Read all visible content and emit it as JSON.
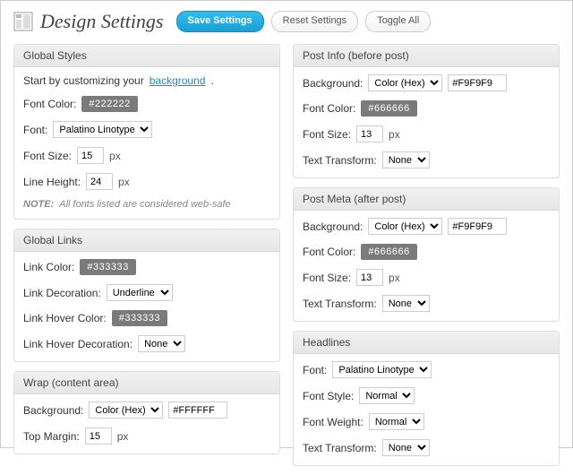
{
  "header": {
    "title": "Design Settings",
    "save": "Save Settings",
    "reset": "Reset Settings",
    "toggle": "Toggle All"
  },
  "global_styles": {
    "title": "Global Styles",
    "intro_prefix": "Start by customizing your ",
    "intro_link": "background",
    "intro_suffix": ".",
    "font_color_label": "Font Color:",
    "font_color": "#222222",
    "font_label": "Font:",
    "font": "Palatino Linotype",
    "font_size_label": "Font Size:",
    "font_size": "15",
    "line_height_label": "Line Height:",
    "line_height": "24",
    "px": "px",
    "note_prefix": "NOTE:",
    "note_text": " All fonts listed are considered web-safe"
  },
  "global_links": {
    "title": "Global Links",
    "link_color_label": "Link Color:",
    "link_color": "#333333",
    "deco_label": "Link Decoration:",
    "deco": "Underline",
    "hover_color_label": "Link Hover Color:",
    "hover_color": "#333333",
    "hover_deco_label": "Link Hover Decoration:",
    "hover_deco": "None"
  },
  "wrap": {
    "title": "Wrap (content area)",
    "bg_label": "Background:",
    "bg_type": "Color (Hex)",
    "bg_value": "#FFFFFF",
    "top_margin_label": "Top Margin:",
    "top_margin": "15",
    "px": "px"
  },
  "post_info": {
    "title": "Post Info (before post)",
    "bg_label": "Background:",
    "bg_type": "Color (Hex)",
    "bg_value": "#F9F9F9",
    "font_color_label": "Font Color:",
    "font_color": "#666666",
    "font_size_label": "Font Size:",
    "font_size": "13",
    "px": "px",
    "tt_label": "Text Transform:",
    "tt": "None"
  },
  "post_meta": {
    "title": "Post Meta (after post)",
    "bg_label": "Background:",
    "bg_type": "Color (Hex)",
    "bg_value": "#F9F9F9",
    "font_color_label": "Font Color:",
    "font_color": "#666666",
    "font_size_label": "Font Size:",
    "font_size": "13",
    "px": "px",
    "tt_label": "Text Transform:",
    "tt": "None"
  },
  "headlines": {
    "title": "Headlines",
    "font_label": "Font:",
    "font": "Palatino Linotype",
    "style_label": "Font Style:",
    "style": "Normal",
    "weight_label": "Font Weight:",
    "weight": "Normal",
    "tt_label": "Text Transform:",
    "tt": "None"
  }
}
